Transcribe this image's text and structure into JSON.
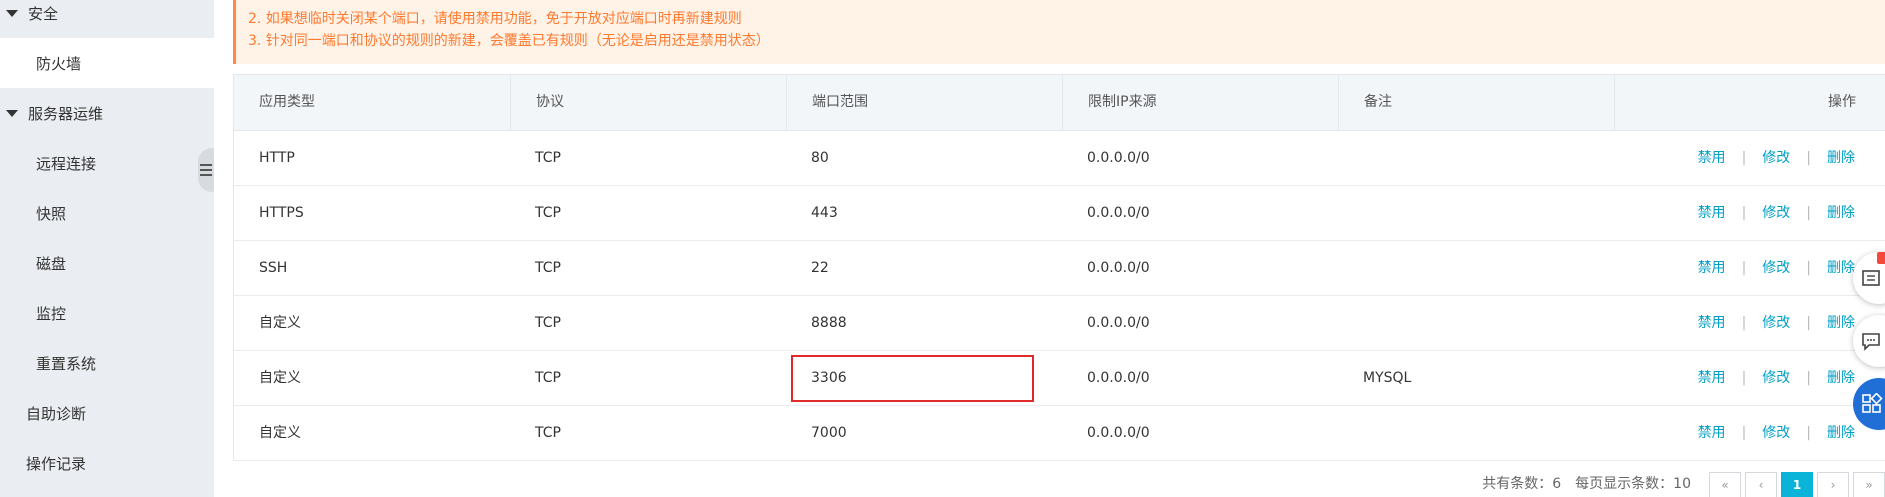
{
  "sidebar": {
    "items": [
      {
        "label": "安全",
        "kind": "section"
      },
      {
        "label": "防火墙",
        "kind": "child",
        "active": true
      },
      {
        "label": "服务器运维",
        "kind": "section"
      },
      {
        "label": "远程连接",
        "kind": "child"
      },
      {
        "label": "快照",
        "kind": "child"
      },
      {
        "label": "磁盘",
        "kind": "child"
      },
      {
        "label": "监控",
        "kind": "child"
      },
      {
        "label": "重置系统",
        "kind": "child"
      },
      {
        "label": "自助诊断",
        "kind": "plain"
      },
      {
        "label": "操作记录",
        "kind": "plain"
      }
    ]
  },
  "notice": {
    "line2": "2. 如果想临时关闭某个端口，请使用禁用功能，免于开放对应端口时再新建规则",
    "line3": "3. 针对同一端口和协议的规则的新建，会覆盖已有规则（无论是启用还是禁用状态）"
  },
  "table": {
    "headers": [
      "应用类型",
      "协议",
      "端口范围",
      "限制IP来源",
      "备注",
      "操作"
    ],
    "rows": [
      {
        "app": "HTTP",
        "protocol": "TCP",
        "port": "80",
        "source": "0.0.0.0/0",
        "note": ""
      },
      {
        "app": "HTTPS",
        "protocol": "TCP",
        "port": "443",
        "source": "0.0.0.0/0",
        "note": ""
      },
      {
        "app": "SSH",
        "protocol": "TCP",
        "port": "22",
        "source": "0.0.0.0/0",
        "note": ""
      },
      {
        "app": "自定义",
        "protocol": "TCP",
        "port": "8888",
        "source": "0.0.0.0/0",
        "note": ""
      },
      {
        "app": "自定义",
        "protocol": "TCP",
        "port": "3306",
        "source": "0.0.0.0/0",
        "note": "MYSQL"
      },
      {
        "app": "自定义",
        "protocol": "TCP",
        "port": "7000",
        "source": "0.0.0.0/0",
        "note": ""
      }
    ],
    "actions": {
      "disable": "禁用",
      "edit": "修改",
      "delete": "删除",
      "separator": "|"
    }
  },
  "pagination": {
    "total_text": "共有条数：6",
    "per_page_text": "每页显示条数：10",
    "first": "«",
    "prev": "‹",
    "current": "1",
    "next": "›",
    "last": "»"
  },
  "colors": {
    "accent": "#00a0c6",
    "notice_text": "#ff7a2f",
    "highlight": "#e02a2a",
    "float_blue": "#1f6fd6"
  }
}
